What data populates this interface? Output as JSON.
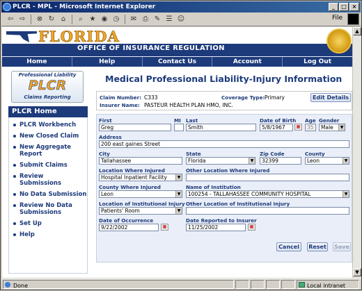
{
  "window": {
    "title": "PLCR - MPL - Microsoft Internet Explorer",
    "menu_file": "File"
  },
  "banner": {
    "brand": "FLORIDA",
    "office": "OFFICE OF INSURANCE REGULATION"
  },
  "nav": [
    "Home",
    "Help",
    "Contact Us",
    "Account",
    "Log Out"
  ],
  "sidebar": {
    "logo": {
      "line1": "Professional Liability",
      "line2": "PLCR",
      "line3": "Claims Reporting"
    },
    "heading": "PLCR Home",
    "items": [
      "PLCR Workbench",
      "New Closed Claim",
      "New Aggregate Report",
      "Submit Claims",
      "Review Submissions",
      "No Data Submission",
      "Review No Data Submissions",
      "Set Up",
      "Help"
    ]
  },
  "page": {
    "title": "Medical Professional Liability-Injury Information"
  },
  "claim": {
    "claim_number_label": "Claim Number:",
    "claim_number": "C333",
    "coverage_type_label": "Coverage Type:",
    "coverage_type": "Primary",
    "insurer_name_label": "Insurer Name:",
    "insurer_name": "PASTEUR HEALTH PLAN HMO, INC.",
    "edit_details": "Edit Details"
  },
  "form": {
    "first_label": "First",
    "first": "Greg",
    "mi_label": "MI",
    "mi": "",
    "last_label": "Last",
    "last": "Smith",
    "dob_label": "Date of Birth",
    "dob": "5/8/1967",
    "age_label": "Age",
    "age": "35",
    "gender_label": "Gender",
    "gender": "Male",
    "address_label": "Address",
    "address": "200 east gaines Street",
    "city_label": "City",
    "city": "Tallahassee",
    "state_label": "State",
    "state": "Florida",
    "zip_label": "Zip Code",
    "zip": "32399",
    "county_label": "County",
    "county": "Leon",
    "location_injured_label": "Location Where Injured",
    "location_injured": "Hospital Inpatient Facility",
    "other_location_label": "Other Location Where Injured",
    "other_location": "",
    "county_injured_label": "County Where Injured",
    "county_injured": "Leon",
    "institution_label": "Name of Institution",
    "institution": "100254 - TALLAHASSEE COMMUNITY HOSPITAL",
    "inst_location_label": "Location of Institutional Injury",
    "inst_location": "Patients' Room",
    "other_inst_location_label": "Other Location of Institutional Injury",
    "other_inst_location": "",
    "occurrence_label": "Date of Occurrence",
    "occurrence": "9/22/2002",
    "reported_label": "Date Reported to Insurer",
    "reported": "11/25/2002"
  },
  "actions": {
    "cancel": "Cancel",
    "reset": "Reset",
    "save": "Save"
  },
  "status": {
    "text": "Done",
    "zone": "Local intranet"
  },
  "colors": {
    "brand_navy": "#1d3a7a",
    "brand_gold": "#f5a623",
    "form_bg": "#e9eef8"
  }
}
